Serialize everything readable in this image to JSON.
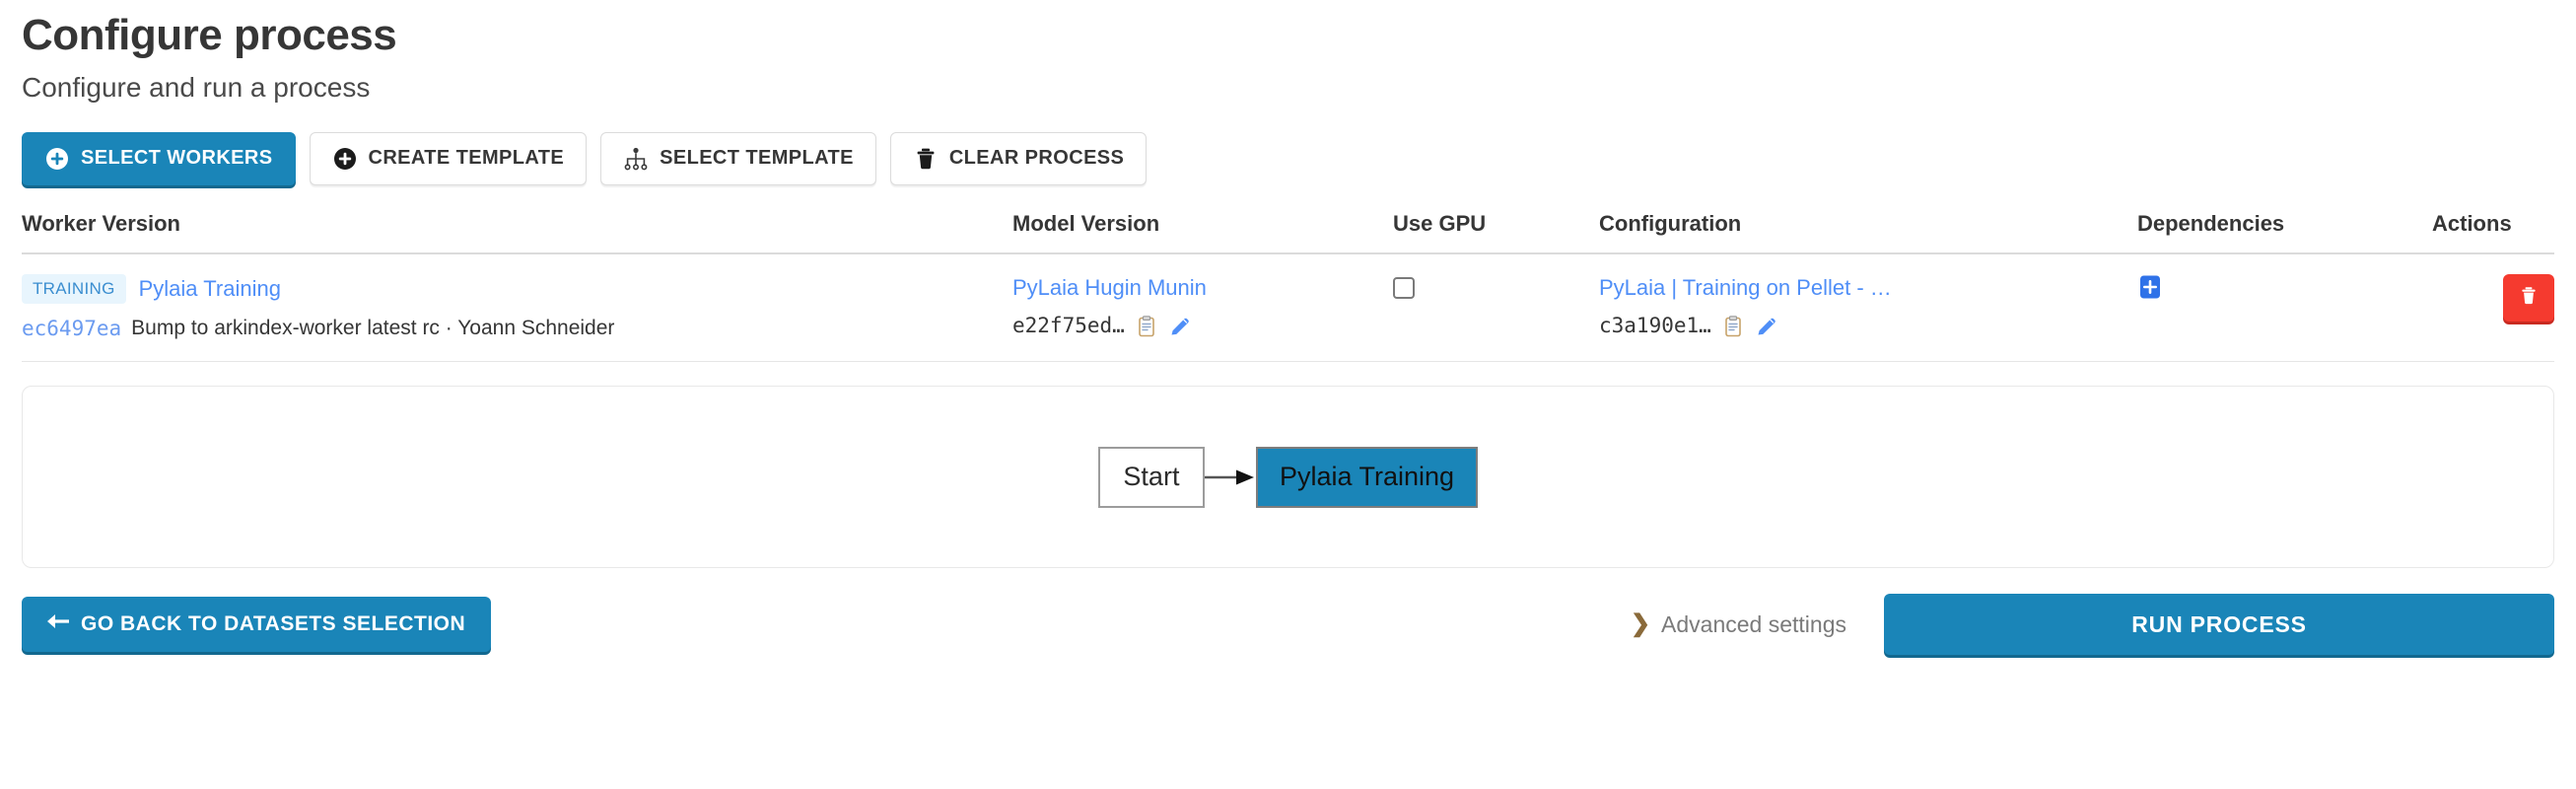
{
  "header": {
    "title": "Configure process",
    "subtitle": "Configure and run a process"
  },
  "toolbar": {
    "buttons": [
      {
        "label": "Select workers",
        "icon": "plus-circle-icon",
        "style": "primary"
      },
      {
        "label": "Create template",
        "icon": "plus-circle-icon",
        "style": "default"
      },
      {
        "label": "Select template",
        "icon": "sitemap-icon",
        "style": "default"
      },
      {
        "label": "Clear process",
        "icon": "trash-icon",
        "style": "default"
      }
    ]
  },
  "table": {
    "columns": [
      "Worker Version",
      "Model Version",
      "Use GPU",
      "Configuration",
      "Dependencies",
      "Actions"
    ],
    "rows": [
      {
        "worker": {
          "tag": "TRAINING",
          "name": "Pylaia Training",
          "commit_hash": "ec6497ea",
          "commit_message": "Bump to arkindex-worker latest rc · Yoann Schneider"
        },
        "model": {
          "name": "PyLaia Hugin Munin",
          "id": "e22f75ed…",
          "copy_icon": "clipboard-icon",
          "edit_icon": "pencil-icon"
        },
        "use_gpu": false,
        "configuration": {
          "name": "PyLaia | Training on Pellet - …",
          "id": "c3a190e1…",
          "copy_icon": "clipboard-icon",
          "edit_icon": "pencil-icon"
        },
        "dependencies": {
          "add_icon": "plus-square-icon"
        },
        "actions": {
          "delete_icon": "trash-icon"
        }
      }
    ]
  },
  "diagram": {
    "nodes": [
      {
        "label": "Start",
        "type": "start"
      },
      {
        "label": "Pylaia Training",
        "type": "worker"
      }
    ],
    "edge_icon": "arrow-right-icon"
  },
  "footer": {
    "back_label": "Go back to datasets selection",
    "back_icon": "arrow-left-icon",
    "advanced_label": "Advanced settings",
    "advanced_icon": "chevron-right-icon",
    "run_label": "Run process"
  },
  "colors": {
    "primary": "#1a85b8",
    "primary_shadow": "#12688f",
    "danger": "#f53a2f",
    "link": "#4f8ef7",
    "tag_bg": "#e8f5fd",
    "tag_text": "#3b8ed0",
    "node_fill": "#1a85b8",
    "text": "#363636",
    "muted": "#7a7a7a"
  }
}
